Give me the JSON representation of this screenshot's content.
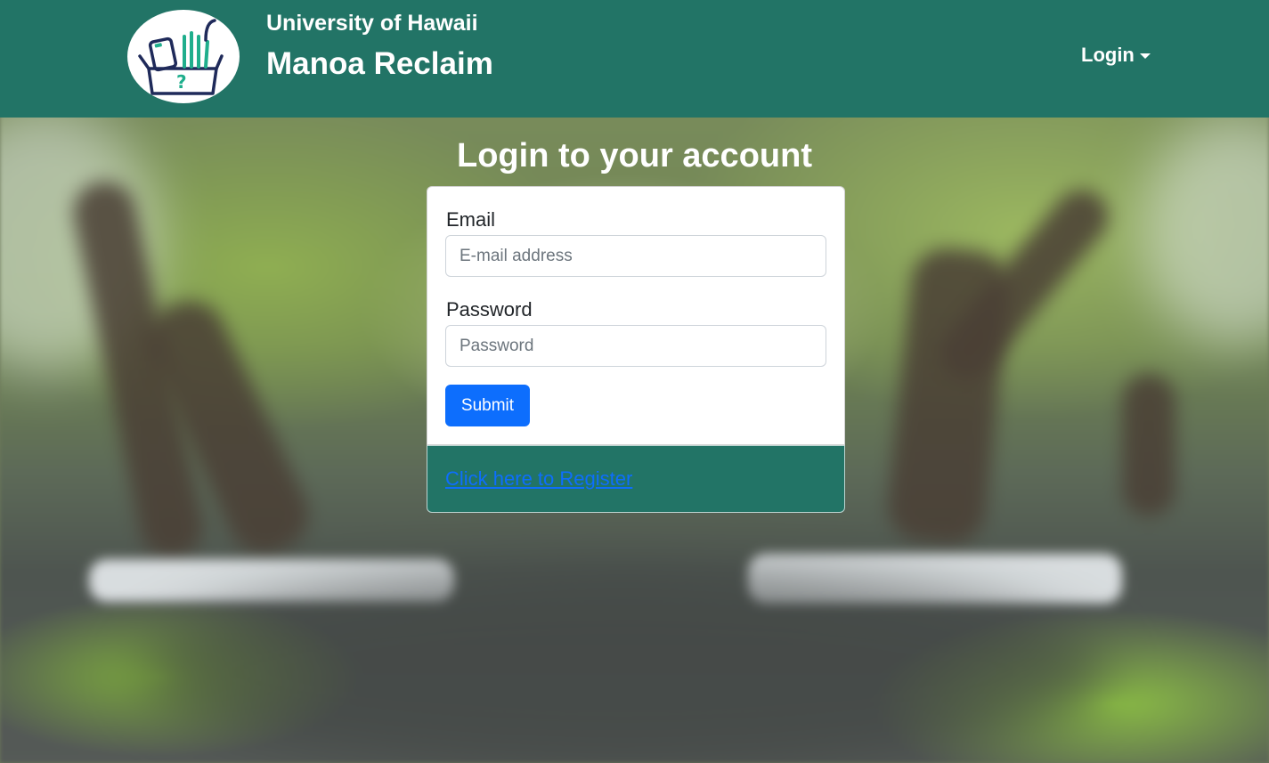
{
  "navbar": {
    "org_name": "University of Hawaii",
    "app_name": "Manoa Reclaim",
    "login_menu_label": "Login",
    "logo_icon": "lost-and-found-box-icon",
    "background_color": "#227466"
  },
  "login": {
    "heading": "Login to your account",
    "email_label": "Email",
    "email_placeholder": "E-mail address",
    "email_value": "",
    "password_label": "Password",
    "password_placeholder": "Password",
    "password_value": "",
    "submit_label": "Submit",
    "register_link": "Click here to Register"
  },
  "colors": {
    "brand": "#227466",
    "primary_button": "#0d6efd",
    "link": "#0d6efd"
  }
}
